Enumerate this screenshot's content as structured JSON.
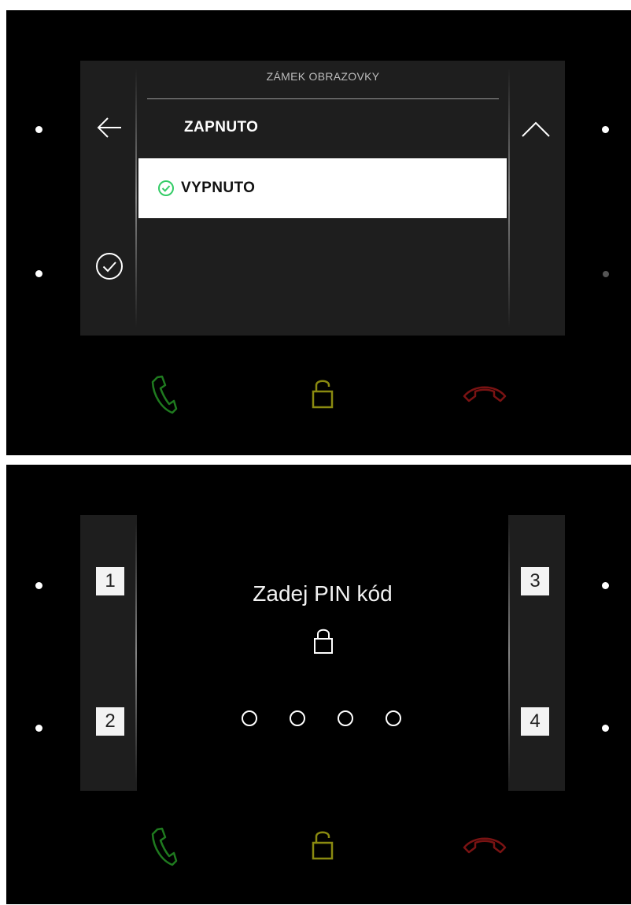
{
  "lock_menu": {
    "title": "ZÁMEK OBRAZOVKY",
    "options": [
      {
        "label": "ZAPNUTO",
        "selected": false
      },
      {
        "label": "VYPNUTO",
        "selected": true
      }
    ],
    "icons": {
      "back": "arrow-left-icon",
      "scroll_up": "chevron-up-icon",
      "confirm": "check-circle-icon",
      "selected_marker": "check-circle-icon"
    }
  },
  "pin_screen": {
    "title": "Zadej PIN kód",
    "keys": [
      "1",
      "2",
      "3",
      "4"
    ],
    "entered_digits": 0,
    "pin_length": 4,
    "icon": "padlock-icon"
  },
  "hardware_buttons": [
    {
      "name": "call-answer",
      "icon": "phone-icon",
      "color": "#1f7a1f"
    },
    {
      "name": "door-unlock",
      "icon": "unlock-icon",
      "color": "#8a8a10"
    },
    {
      "name": "call-hangup",
      "icon": "phone-hangup-icon",
      "color": "#7a1313"
    }
  ],
  "colors": {
    "screen_bg": "#1e1e1e",
    "device_bg": "#000000",
    "selected_bg": "#ffffff",
    "selected_check": "#33cc66",
    "led": "#ffffff",
    "led_dim": "#555555"
  }
}
